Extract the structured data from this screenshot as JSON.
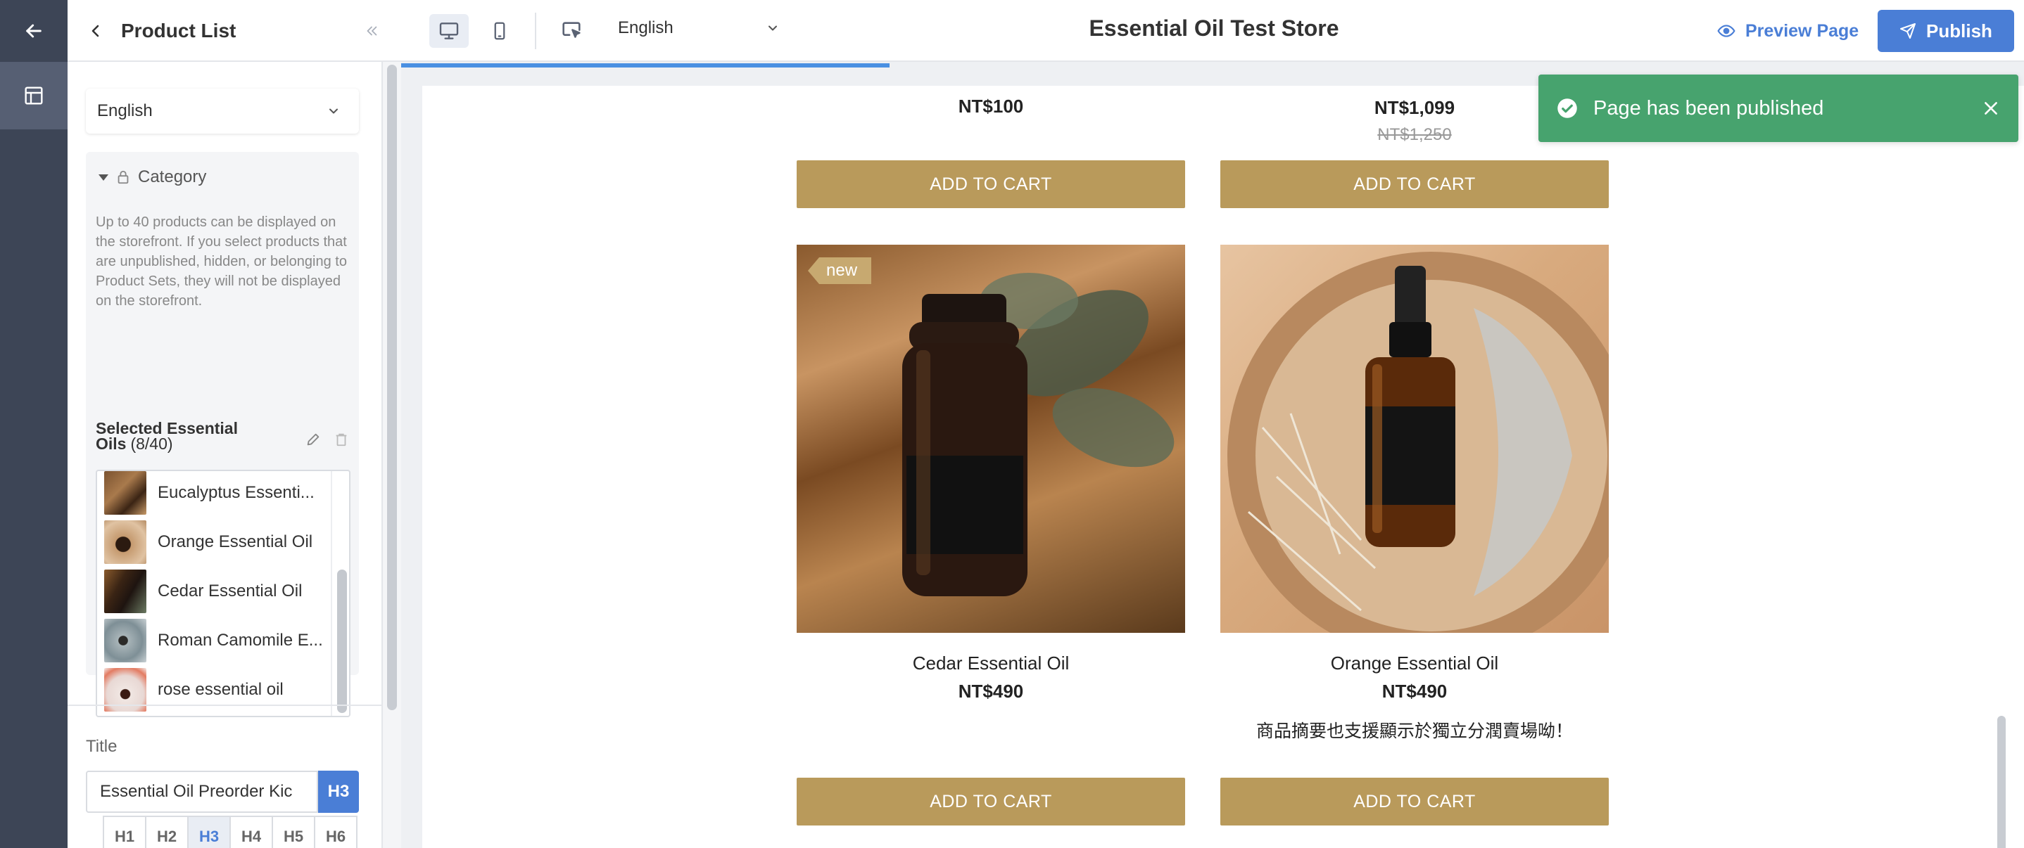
{
  "header": {
    "panel_title": "Product List",
    "language": "English",
    "store_title": "Essential Oil Test Store",
    "preview_label": "Preview Page",
    "publish_label": "Publish"
  },
  "panel": {
    "language": "English",
    "category_label": "Category",
    "category_description": "Up to 40 products can be displayed on the storefront. If you select products that are unpublished, hidden, or belonging to Product Sets, they will not be displayed on the storefront.",
    "selected_title_line1": "Selected Essential",
    "selected_title_line2": "Oils",
    "selected_count": "(8/40)",
    "selected_items": [
      {
        "name": "Eucalyptus Essential Oil",
        "display": "Eucalyptus Essenti..."
      },
      {
        "name": "Orange Essential Oil",
        "display": "Orange Essential Oil"
      },
      {
        "name": "Cedar Essential Oil",
        "display": "Cedar Essential Oil"
      },
      {
        "name": "Roman Camomile Essential Oil",
        "display": "Roman Camomile E..."
      },
      {
        "name": "rose essential oil",
        "display": "rose essential oil"
      }
    ],
    "title_label": "Title",
    "title_value": "Essential Oil Preorder Kic",
    "heading_selected": "H3",
    "heading_options": [
      "H1",
      "H2",
      "H3",
      "H4",
      "H5",
      "H6"
    ]
  },
  "products": {
    "top_left": {
      "price": "NT$100",
      "button": "ADD TO CART"
    },
    "top_right": {
      "price": "NT$1,099",
      "old_price": "NT$1,250",
      "button": "ADD TO CART"
    },
    "cedar": {
      "badge": "new",
      "name": "Cedar Essential Oil",
      "price": "NT$490",
      "button": "ADD TO CART"
    },
    "orange": {
      "name": "Orange Essential Oil",
      "price": "NT$490",
      "description": "商品摘要也支援顯示於獨立分潤賣場呦！",
      "button": "ADD TO CART"
    }
  },
  "toast": {
    "message": "Page has been published"
  },
  "colors": {
    "accent": "#4a7ed6",
    "add_to_cart": "#b99a5b",
    "toast_success": "#47a36e",
    "rail": "#3d4556"
  }
}
